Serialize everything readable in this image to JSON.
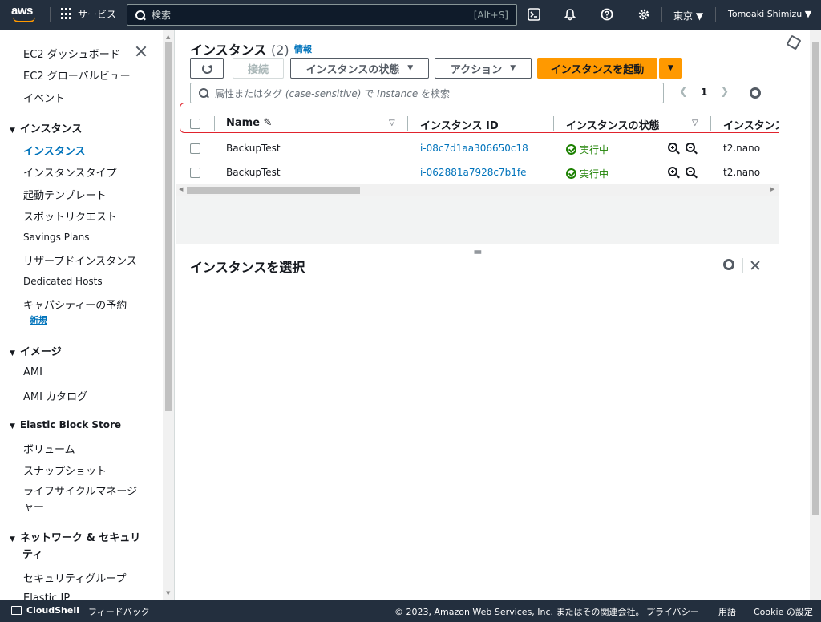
{
  "topnav": {
    "logo": "aws",
    "services": "サービス",
    "search_placeholder": "検索",
    "search_shortcut": "[Alt+S]",
    "region": "東京 ▼",
    "user": "Tomoaki Shimizu ▼"
  },
  "leftnav": {
    "top_items": [
      "EC2 ダッシュボード",
      "EC2 グローバルビュー",
      "イベント"
    ],
    "sections": [
      {
        "title": "インスタンス",
        "items": [
          "インスタンス",
          "インスタンスタイプ",
          "起動テンプレート",
          "スポットリクエスト",
          "Savings Plans",
          "リザーブドインスタンス",
          "Dedicated Hosts",
          "キャパシティーの予約"
        ],
        "active_index": 0,
        "badge": "新規"
      },
      {
        "title": "イメージ",
        "items": [
          "AMI",
          "AMI カタログ"
        ]
      },
      {
        "title": "Elastic Block Store",
        "items": [
          "ボリューム",
          "スナップショット",
          "ライフサイクルマネージャー"
        ]
      },
      {
        "title": "ネットワーク & セキュリティ",
        "items": [
          "セキュリティグループ",
          "Elastic IP"
        ]
      }
    ]
  },
  "main": {
    "title": "インスタンス",
    "count": "(2)",
    "info": "情報",
    "buttons": {
      "connect": "接続",
      "instance_state": "インスタンスの状態",
      "actions": "アクション",
      "launch": "インスタンスを起動"
    },
    "filter_placeholder_a": "属性またはタグ",
    "filter_placeholder_b": "(case-sensitive)",
    "filter_placeholder_c": "で",
    "filter_placeholder_d": "Instance",
    "filter_placeholder_e": "を検索",
    "page": "1",
    "columns": [
      "Name",
      "インスタンス ID",
      "インスタンスの状態",
      "インスタンス"
    ],
    "rows": [
      {
        "name": "BackupTest",
        "id": "i-08c7d1aa306650c18",
        "state": "実行中",
        "type": "t2.nano"
      },
      {
        "name": "BackupTest",
        "id": "i-062881a7928c7b1fe",
        "state": "実行中",
        "type": "t2.nano"
      }
    ],
    "split_title": "インスタンスを選択"
  },
  "footer": {
    "cloudshell": "CloudShell",
    "feedback": "フィードバック",
    "copyright": "© 2023, Amazon Web Services, Inc. またはその関連会社。",
    "privacy": "プライバシー",
    "terms": "用語",
    "cookie": "Cookie の設定"
  },
  "colors": {
    "nav_bg": "#232f3e",
    "accent": "#ff9900",
    "link": "#0073bb",
    "running": "#1d8102",
    "highlight": "#e0232d"
  }
}
